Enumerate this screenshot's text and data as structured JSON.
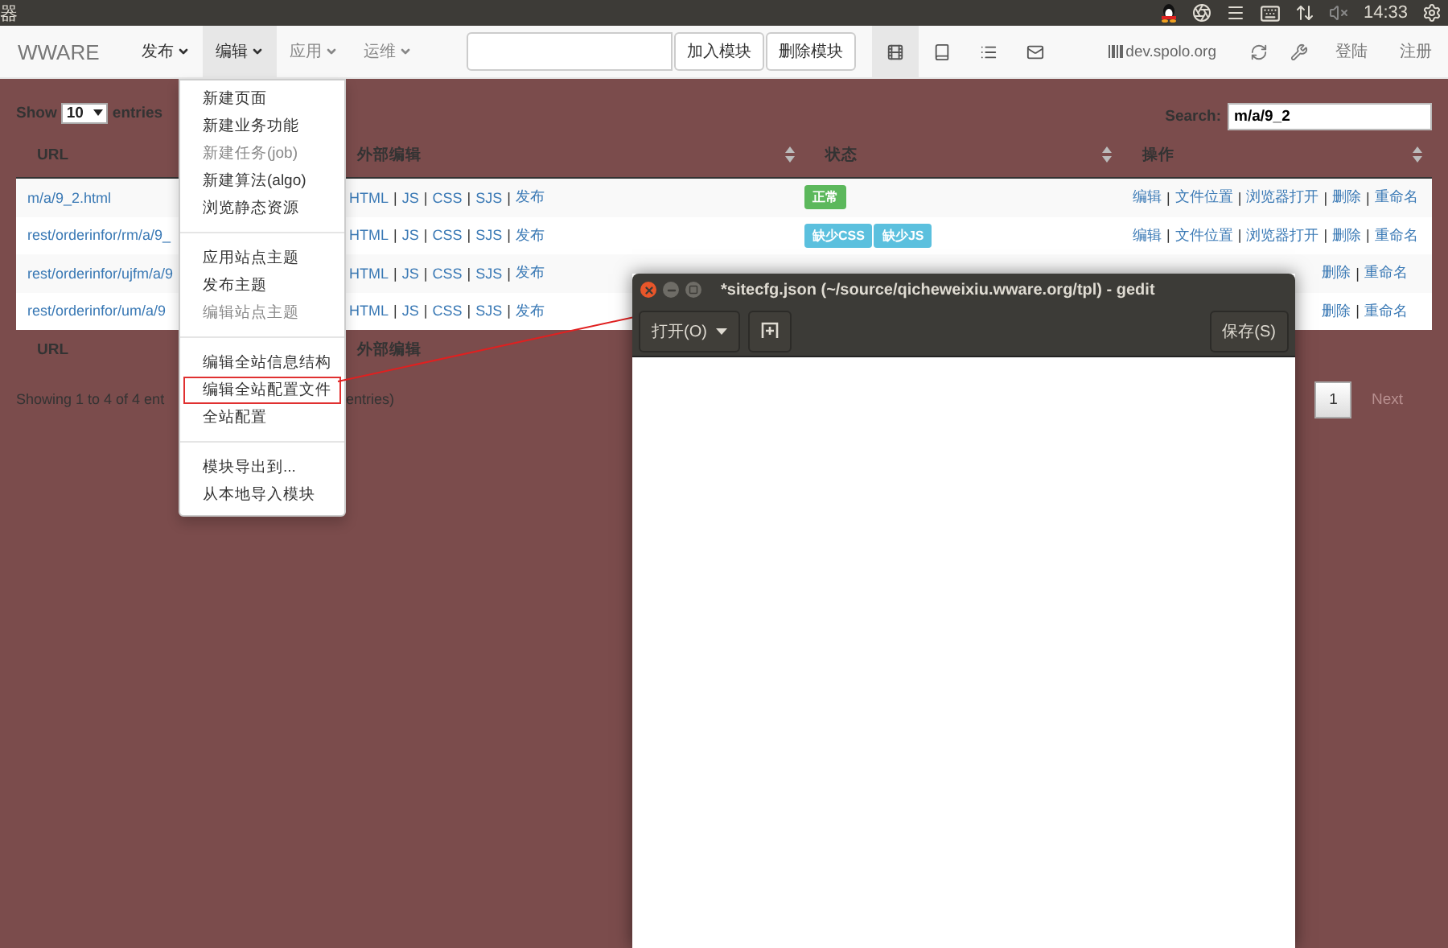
{
  "top_panel": {
    "app_fragment": "器",
    "clock": "14:33"
  },
  "navbar": {
    "brand": "WWARE",
    "menus": [
      {
        "label": "发布",
        "selected": false,
        "disabled": false
      },
      {
        "label": "编辑",
        "selected": true,
        "disabled": false
      },
      {
        "label": "应用",
        "selected": false,
        "disabled": true
      },
      {
        "label": "运维",
        "selected": false,
        "disabled": true
      }
    ],
    "buttons": [
      "加入模块",
      "删除模块"
    ],
    "view_icons": [
      {
        "kind": "film",
        "selected": true
      },
      {
        "kind": "book",
        "selected": false
      },
      {
        "kind": "list",
        "selected": false
      },
      {
        "kind": "mail",
        "selected": false
      }
    ],
    "site": "dev.spolo.org",
    "user_links": [
      "登陆",
      "注册"
    ]
  },
  "menu": {
    "sections": [
      [
        {
          "label": "新建页面",
          "disabled": false,
          "highlighted": false
        },
        {
          "label": "新建业务功能",
          "disabled": false,
          "highlighted": false
        },
        {
          "label": "新建任务(job)",
          "disabled": true,
          "highlighted": false
        },
        {
          "label": "新建算法(algo)",
          "disabled": false,
          "highlighted": false
        },
        {
          "label": "浏览静态资源",
          "disabled": false,
          "highlighted": false
        }
      ],
      [
        {
          "label": "应用站点主题",
          "disabled": false,
          "highlighted": false
        },
        {
          "label": "发布主题",
          "disabled": false,
          "highlighted": false
        },
        {
          "label": "编辑站点主题",
          "disabled": true,
          "highlighted": false
        }
      ],
      [
        {
          "label": "编辑全站信息结构",
          "disabled": false,
          "highlighted": false
        },
        {
          "label": "编辑全站配置文件",
          "disabled": false,
          "highlighted": true
        },
        {
          "label": "全站配置",
          "disabled": false,
          "highlighted": false
        }
      ],
      [
        {
          "label": "模块导出到...",
          "disabled": false,
          "highlighted": false
        },
        {
          "label": "从本地导入模块",
          "disabled": false,
          "highlighted": false
        }
      ]
    ]
  },
  "table": {
    "show_label": "Show",
    "length_value": "10",
    "entries_label": "entries",
    "search_label": "Search:",
    "search_value": "m/a/9_2",
    "columns": [
      "URL",
      "外部编辑",
      "状态",
      "操作"
    ],
    "separator": "|",
    "rows": [
      {
        "url": "m/a/9_2.html",
        "external": [
          "HTML",
          "JS",
          "CSS",
          "SJS",
          "发布"
        ],
        "status": [
          {
            "label": "正常",
            "kind": "success"
          }
        ],
        "actions": [
          "编辑",
          "文件位置",
          "浏览器打开",
          "删除",
          "重命名"
        ]
      },
      {
        "url": "rest/orderinfor/rm/a/9_",
        "external": [
          "HTML",
          "JS",
          "CSS",
          "SJS",
          "发布"
        ],
        "status": [
          {
            "label": "缺少CSS",
            "kind": "info"
          },
          {
            "label": "缺少JS",
            "kind": "info"
          }
        ],
        "actions": [
          "编辑",
          "文件位置",
          "浏览器打开",
          "删除",
          "重命名"
        ]
      },
      {
        "url": "rest/orderinfor/ujfm/a/9",
        "external": [
          "HTML",
          "JS",
          "CSS",
          "SJS",
          "发布"
        ],
        "status": [],
        "actions": [
          "删除",
          "重命名"
        ]
      },
      {
        "url": "rest/orderinfor/um/a/9",
        "external": [
          "HTML",
          "JS",
          "CSS",
          "SJS",
          "发布"
        ],
        "status": [],
        "actions": [
          "删除",
          "重命名"
        ]
      }
    ],
    "footer_columns": [
      "URL",
      "外部编辑"
    ],
    "info": [
      "Showing 1 to 4 of 4 ent",
      "entries)"
    ],
    "pagination": {
      "pages": [
        {
          "label": "1",
          "selected": true
        }
      ],
      "next": "Next"
    }
  },
  "gedit": {
    "title": "*sitecfg.json (~/source/qicheweixiu.wware.org/tpl) - gedit",
    "open_button": "打开(O)",
    "save_button": "保存(S)"
  }
}
